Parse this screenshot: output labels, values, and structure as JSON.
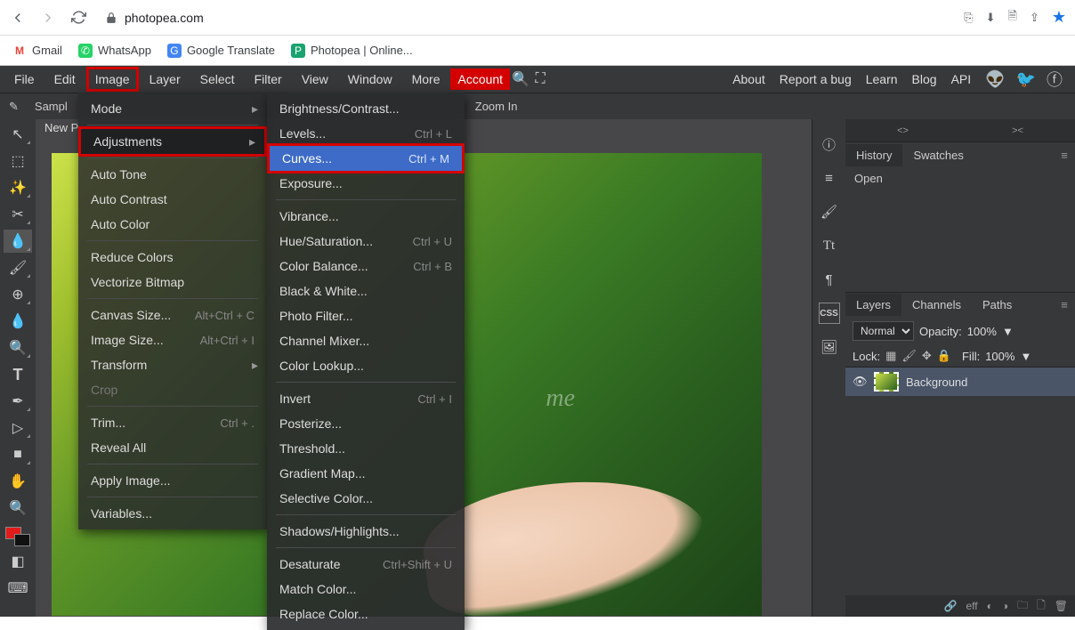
{
  "browser": {
    "url": "photopea.com",
    "bookmarks": [
      {
        "label": "Gmail",
        "icon": "M"
      },
      {
        "label": "WhatsApp",
        "icon": "✆"
      },
      {
        "label": "Google Translate",
        "icon": "G"
      },
      {
        "label": "Photopea | Online...",
        "icon": "P"
      }
    ]
  },
  "menubar": {
    "items": [
      "File",
      "Edit",
      "Image",
      "Layer",
      "Select",
      "Filter",
      "View",
      "Window",
      "More"
    ],
    "account": "Account",
    "right": [
      "About",
      "Report a bug",
      "Learn",
      "Blog",
      "API"
    ]
  },
  "options": {
    "left": "Sampl",
    "newp": "New P",
    "zoom": "Zoom In"
  },
  "image_menu": {
    "groups": [
      [
        {
          "label": "Mode",
          "sub": true
        }
      ],
      [
        {
          "label": "Adjustments",
          "sub": true,
          "hi": true
        }
      ],
      [
        {
          "label": "Auto Tone"
        },
        {
          "label": "Auto Contrast"
        },
        {
          "label": "Auto Color"
        }
      ],
      [
        {
          "label": "Reduce Colors"
        },
        {
          "label": "Vectorize Bitmap"
        }
      ],
      [
        {
          "label": "Canvas Size...",
          "sc": "Alt+Ctrl + C"
        },
        {
          "label": "Image Size...",
          "sc": "Alt+Ctrl + I"
        },
        {
          "label": "Transform",
          "sub": true
        },
        {
          "label": "Crop",
          "dis": true
        }
      ],
      [
        {
          "label": "Trim...",
          "sc": "Ctrl + ."
        },
        {
          "label": "Reveal All"
        }
      ],
      [
        {
          "label": "Apply Image..."
        }
      ],
      [
        {
          "label": "Variables..."
        }
      ]
    ]
  },
  "adjust_menu": {
    "groups": [
      [
        {
          "label": "Brightness/Contrast..."
        },
        {
          "label": "Levels...",
          "sc": "Ctrl + L"
        },
        {
          "label": "Curves...",
          "sc": "Ctrl + M",
          "hov": true
        },
        {
          "label": "Exposure..."
        }
      ],
      [
        {
          "label": "Vibrance..."
        },
        {
          "label": "Hue/Saturation...",
          "sc": "Ctrl + U"
        },
        {
          "label": "Color Balance...",
          "sc": "Ctrl + B"
        },
        {
          "label": "Black & White..."
        },
        {
          "label": "Photo Filter..."
        },
        {
          "label": "Channel Mixer..."
        },
        {
          "label": "Color Lookup..."
        }
      ],
      [
        {
          "label": "Invert",
          "sc": "Ctrl + I"
        },
        {
          "label": "Posterize..."
        },
        {
          "label": "Threshold..."
        },
        {
          "label": "Gradient Map..."
        },
        {
          "label": "Selective Color..."
        }
      ],
      [
        {
          "label": "Shadows/Highlights..."
        }
      ],
      [
        {
          "label": "Desaturate",
          "sc": "Ctrl+Shift + U"
        },
        {
          "label": "Match Color..."
        },
        {
          "label": "Replace Color..."
        }
      ]
    ]
  },
  "history": {
    "tab1": "History",
    "tab2": "Swatches",
    "item": "Open"
  },
  "layers": {
    "tabs": [
      "Layers",
      "Channels",
      "Paths"
    ],
    "blend": "Normal",
    "opacity_label": "Opacity:",
    "opacity": "100%",
    "lock_label": "Lock:",
    "fill_label": "Fill:",
    "fill": "100%",
    "item": "Background"
  },
  "watermark": "me",
  "footer_eff": "eff"
}
